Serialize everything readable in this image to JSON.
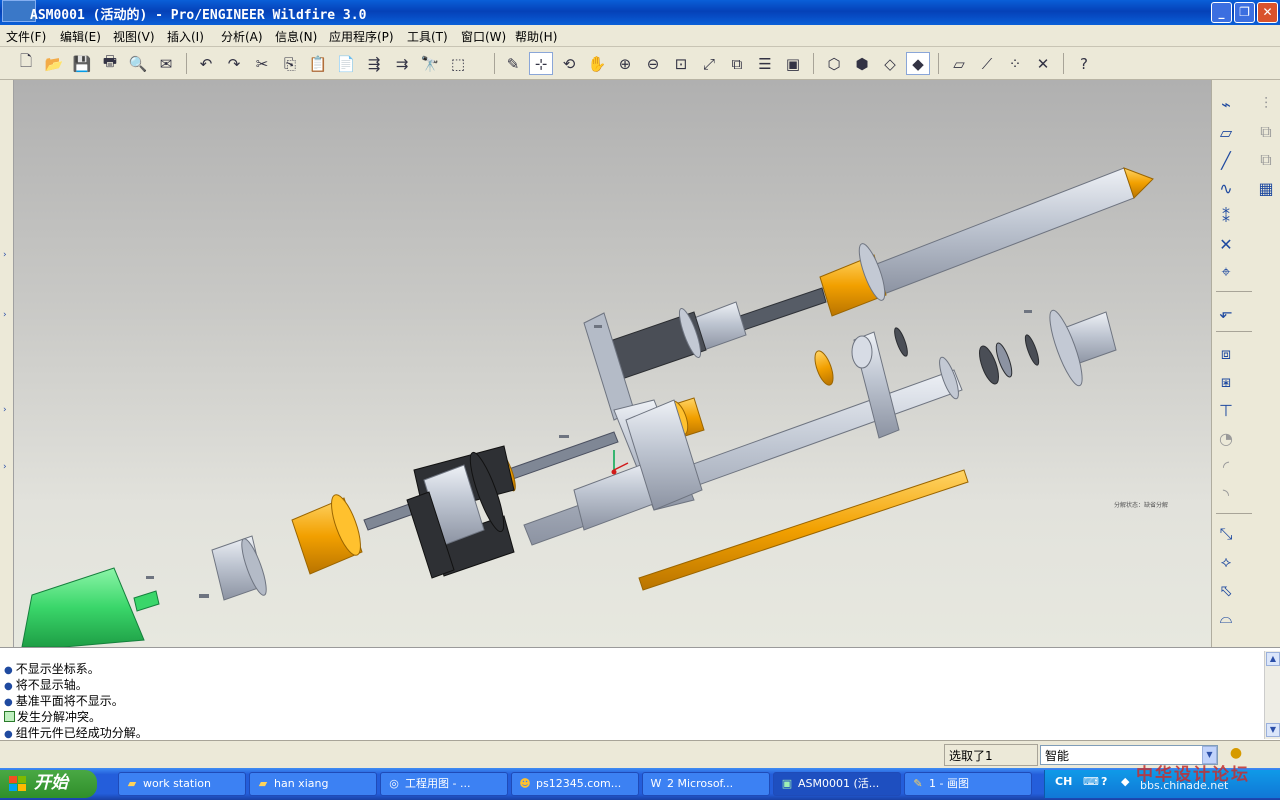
{
  "window": {
    "title": "ASM0001 (活动的) - Pro/ENGINEER Wildfire 3.0",
    "controls": {
      "minimize": "_",
      "maximize": "❐",
      "close": "✕"
    }
  },
  "menu": [
    "文件(F)",
    "编辑(E)",
    "视图(V)",
    "插入(I)",
    "分析(A)",
    "信息(N)",
    "应用程序(P)",
    "工具(T)",
    "窗口(W)",
    "帮助(H)"
  ],
  "toolbar_icons": [
    "new-icon",
    "open-icon",
    "save-icon",
    "print-icon",
    "preview-icon",
    "email-icon",
    "undo-icon",
    "redo-icon",
    "cut-icon",
    "copy-icon",
    "paste-icon",
    "paste-special-icon",
    "regenerate-icon",
    "regen-manager-icon",
    "find-icon",
    "select-box-icon",
    "sketch-icon",
    "spin-center-icon",
    "orient-icon",
    "pan-icon",
    "zoom-in-icon",
    "zoom-out-icon",
    "refit-icon",
    "reorient-icon",
    "saved-views-icon",
    "layers-icon",
    "view-manager-icon",
    "wireframe-icon",
    "hidden-line-icon",
    "no-hidden-icon",
    "shading-icon",
    "datum-plane-display-icon",
    "axis-display-icon",
    "point-display-icon",
    "csys-display-icon",
    "help-icon"
  ],
  "model": {
    "small_label": "分解状态：缺省分解",
    "colors": {
      "steel": "#c3c9d4",
      "brass": "#f2a000",
      "motor": "#3ad66a",
      "dark": "#3a3a3a"
    }
  },
  "right_tools": [
    "datum-plane-icon",
    "sketch-plane-icon",
    "datum-axis-icon",
    "datum-curve-icon",
    "datum-point-icon",
    "offset-point-icon",
    "datum-csys-icon",
    "annotation-icon",
    "component-icon",
    "create-component-icon",
    "pattern-icon",
    "merge-icon",
    "round-icon",
    "chamfer-icon",
    "copy-feature-icon",
    "mirror-icon",
    "move-icon",
    "surface-icon"
  ],
  "messages": [
    {
      "type": "info",
      "text": "不显示坐标系。"
    },
    {
      "type": "info",
      "text": "将不显示轴。"
    },
    {
      "type": "info",
      "text": "基准平面将不显示。"
    },
    {
      "type": "warning",
      "text": "发生分解冲突。"
    },
    {
      "type": "info",
      "text": "组件元件已经成功分解。"
    }
  ],
  "status": {
    "selected": "选取了1",
    "filter": "智能"
  },
  "taskbar": {
    "start": "开始",
    "tasks": [
      {
        "label": "work station",
        "icon": "folder-icon"
      },
      {
        "label": "han xiang",
        "icon": "folder-icon"
      },
      {
        "label": "工程用图 - ...",
        "icon": "browser-icon"
      },
      {
        "label": "ps12345.com...",
        "icon": "chat-icon"
      },
      {
        "label": "2 Microsof...",
        "icon": "word-icon"
      },
      {
        "label": "ASM0001 (活...",
        "icon": "proe-icon"
      },
      {
        "label": "1 - 画图",
        "icon": "paint-icon"
      }
    ],
    "tray_lang": "CH",
    "watermark": "中华设计论坛",
    "watermark_url": "bbs.chinade.net"
  }
}
